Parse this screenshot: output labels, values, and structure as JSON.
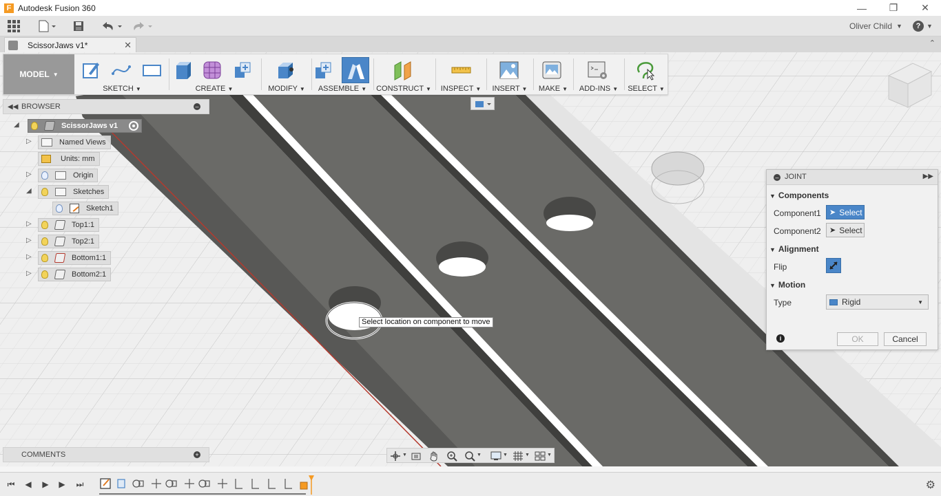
{
  "window": {
    "title": "Autodesk Fusion 360"
  },
  "quick_access": {
    "user_name": "Oliver Child",
    "help_label": "?"
  },
  "document": {
    "tab_title": "ScissorJaws v1*"
  },
  "toolbar": {
    "workspace": "MODEL",
    "groups": [
      {
        "label": "SKETCH"
      },
      {
        "label": "CREATE"
      },
      {
        "label": "MODIFY"
      },
      {
        "label": "ASSEMBLE"
      },
      {
        "label": "CONSTRUCT"
      },
      {
        "label": "INSPECT"
      },
      {
        "label": "INSERT"
      },
      {
        "label": "MAKE"
      },
      {
        "label": "ADD-INS"
      },
      {
        "label": "SELECT"
      }
    ]
  },
  "browser": {
    "title": "BROWSER",
    "root": "ScissorJaws v1",
    "items": [
      {
        "label": "Named Views"
      },
      {
        "label": "Units: mm"
      },
      {
        "label": "Origin"
      },
      {
        "label": "Sketches"
      },
      {
        "label": "Sketch1"
      },
      {
        "label": "Top1:1"
      },
      {
        "label": "Top2:1"
      },
      {
        "label": "Bottom1:1"
      },
      {
        "label": "Bottom2:1"
      }
    ]
  },
  "viewport": {
    "tooltip": "Select location on component to move"
  },
  "joint_dialog": {
    "title": "JOINT",
    "sections": {
      "components": "Components",
      "alignment": "Alignment",
      "motion": "Motion"
    },
    "component1_label": "Component1",
    "component1_value": "Select",
    "component2_label": "Component2",
    "component2_value": "Select",
    "flip_label": "Flip",
    "type_label": "Type",
    "type_value": "Rigid",
    "ok_label": "OK",
    "cancel_label": "Cancel"
  },
  "comments": {
    "title": "COMMENTS"
  },
  "colors": {
    "accent": "#4a86c8",
    "model_button": "#999999",
    "bar_fill": "#6b6b69",
    "bar_edge": "#3e3e3c",
    "grid_bg": "#eeeeee"
  }
}
